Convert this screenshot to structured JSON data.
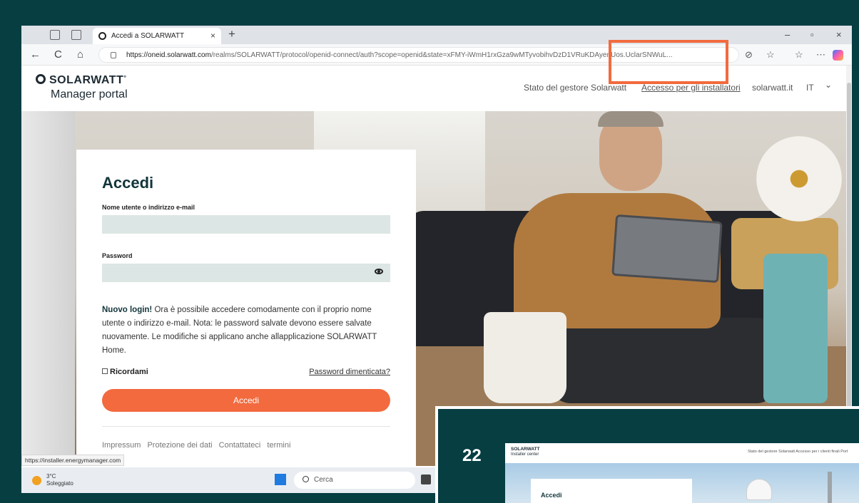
{
  "browser": {
    "tab_title": "Accedi a SOLARWATT",
    "tab_close": "×",
    "new_tab": "+",
    "url_domain": "https://oneid.solarwatt.com",
    "url_path": "/realms/SOLARWATT/protocol/openid-connect/auth?scope=openid&state=xFMY-iWmH1rxGza9wMTyvobihvDzD1VRuKDAyenUos.UclarSNWuL...",
    "minimize": "–",
    "maximize": "▫",
    "close": "×",
    "back": "←",
    "reload": "C",
    "home": "⌂"
  },
  "site": {
    "brand": "SOLARWATT",
    "brand_mark": "°",
    "product": "Manager portal",
    "nav": {
      "status": "Stato del gestore Solarwatt",
      "installer_access": "Accesso per gli installatori",
      "site_link": "solarwatt.it",
      "language": "IT",
      "language_chevron": "⌄"
    }
  },
  "login": {
    "title": "Accedi",
    "username_label": "Nome utente o indirizzo e-mail",
    "username_value": "",
    "password_label": "Password",
    "password_value": "",
    "notice_bold": "Nuovo login!",
    "notice_text": " Ora è possibile accedere comodamente con il proprio nome utente o indirizzo e-mail. Nota: le password salvate devono essere salvate nuovamente. Le modifiche si applicano anche allapplicazione SOLARWATT Home.",
    "remember_label": "Ricordami",
    "forgot_link": "Password dimenticata?",
    "submit_label": "Accedi",
    "footer": [
      "Impressum",
      "Protezione dei dati",
      "Contattateci",
      "termini"
    ]
  },
  "status_bar_url": "https://installer.energymanager.com",
  "taskbar": {
    "temperature": "3°C",
    "weather": "Soleggiato",
    "search_placeholder": "Cerca"
  },
  "inset": {
    "step_number": "22",
    "brand": "SOLARWATT",
    "product": "Installer center",
    "nav": "Stato del gestore Solarwatt   Accesso per i clienti finali   Port",
    "login_title": "Accedi"
  },
  "colors": {
    "accent": "#f26a3e",
    "background": "#063e42",
    "input_fill": "#dce6e4"
  }
}
